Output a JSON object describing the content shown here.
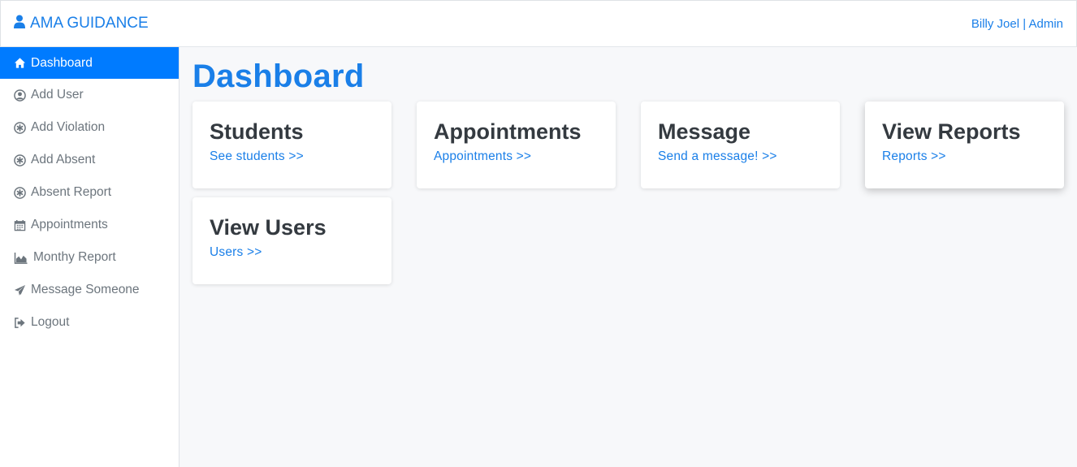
{
  "navbar": {
    "brand": "AMA GUIDANCE",
    "user": "Billy Joel | Admin"
  },
  "sidebar": {
    "items": [
      {
        "label": "Dashboard",
        "icon": "home-icon"
      },
      {
        "label": "Add User",
        "icon": "user-circle-icon"
      },
      {
        "label": "Add Violation",
        "icon": "asterisk-circle-icon"
      },
      {
        "label": "Add Absent",
        "icon": "asterisk-circle-icon"
      },
      {
        "label": "Absent Report",
        "icon": "asterisk-circle-icon"
      },
      {
        "label": "Appointments",
        "icon": "calendar-icon"
      },
      {
        "label": "Monthy Report",
        "icon": "area-chart-icon"
      },
      {
        "label": "Message Someone",
        "icon": "paper-plane-icon"
      },
      {
        "label": "Logout",
        "icon": "sign-out-icon"
      }
    ]
  },
  "main": {
    "title": "Dashboard",
    "cards": [
      {
        "title": "Students",
        "link": "See students >>"
      },
      {
        "title": "Appointments",
        "link": "Appointments >>"
      },
      {
        "title": "Message",
        "link": "Send a message! >>"
      },
      {
        "title": "View Reports",
        "link": "Reports >>"
      },
      {
        "title": "View Users",
        "link": "Users >>"
      }
    ]
  },
  "colors": {
    "accent": "#007bff",
    "link": "#1a7fe8",
    "background": "#f7f8fa"
  }
}
